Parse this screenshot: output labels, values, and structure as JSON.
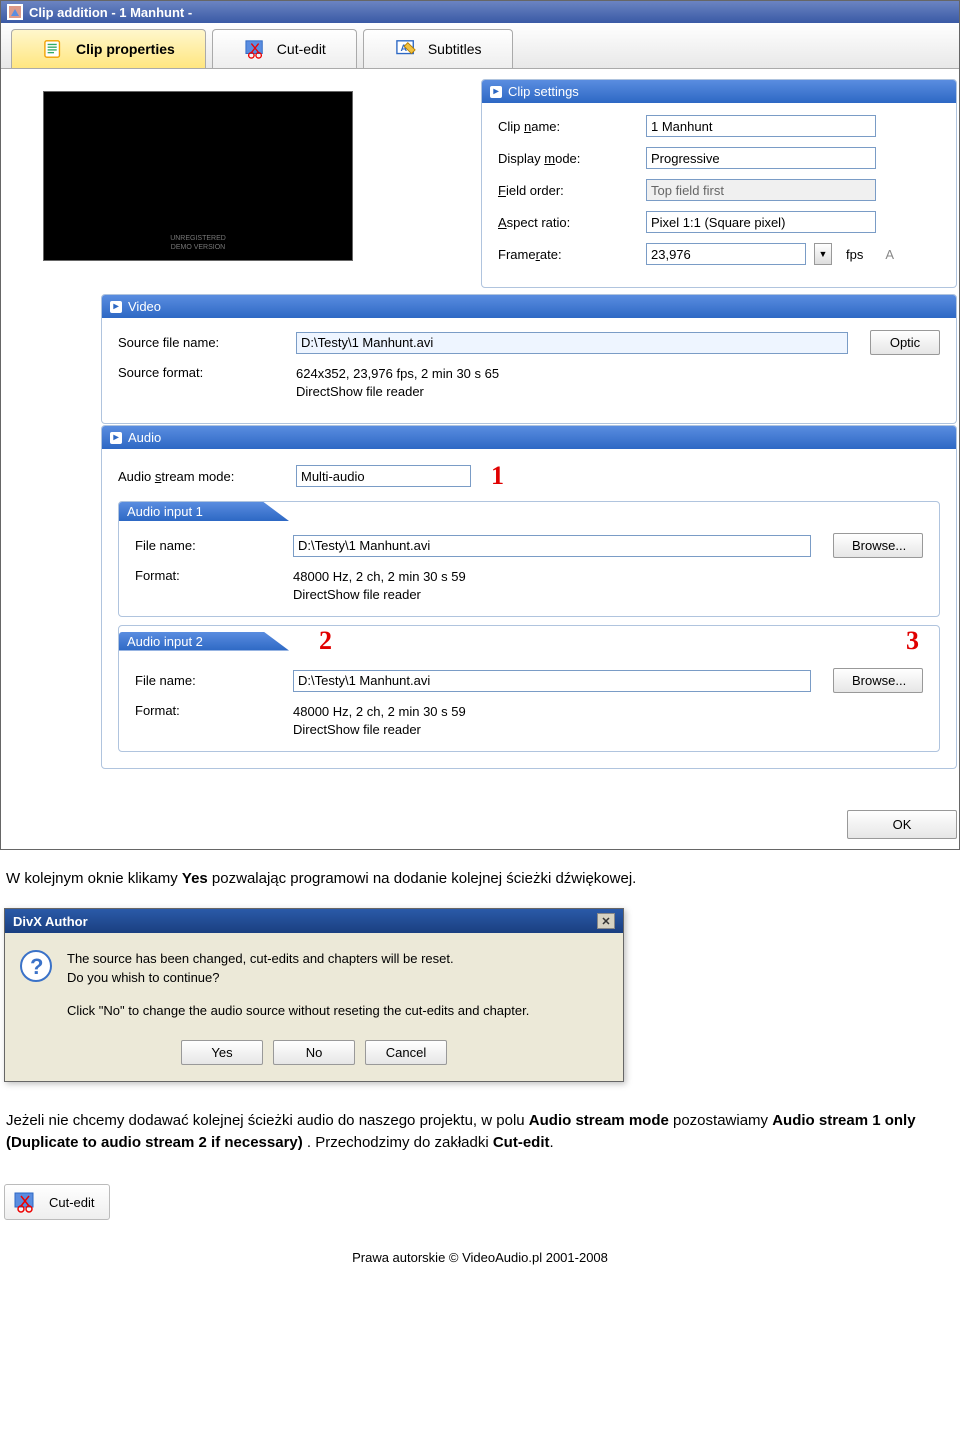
{
  "window": {
    "title": "Clip addition - 1 Manhunt -"
  },
  "tabs": {
    "clip_properties": "Clip properties",
    "cut_edit": "Cut-edit",
    "subtitles": "Subtitles"
  },
  "clip_settings": {
    "header": "Clip settings",
    "clip_name_label": "Clip name:",
    "clip_name_value": "1 Manhunt",
    "display_mode_label": "Display mode:",
    "display_mode_value": "Progressive",
    "field_order_label": "Field order:",
    "field_order_value": "Top field first",
    "aspect_ratio_label": "Aspect ratio:",
    "aspect_ratio_value": "Pixel 1:1 (Square pixel)",
    "framerate_label": "Framerate:",
    "framerate_value": "23,976",
    "fps_unit": "fps",
    "ar_btn": "A"
  },
  "video": {
    "header": "Video",
    "source_file_label": "Source file name:",
    "source_file_value": "D:\\Testy\\1 Manhunt.avi",
    "source_format_label": "Source format:",
    "source_format_value_l1": "624x352, 23,976 fps, 2 min 30 s 65",
    "source_format_value_l2": "DirectShow file reader",
    "option_btn": "Optic"
  },
  "audio": {
    "header": "Audio",
    "stream_mode_label": "Audio stream mode:",
    "stream_mode_value": "Multi-audio",
    "marker1": "1",
    "input1": {
      "header": "Audio input 1",
      "file_name_label": "File name:",
      "file_name_value": "D:\\Testy\\1 Manhunt.avi",
      "format_label": "Format:",
      "format_l1": "48000 Hz, 2 ch, 2 min 30 s 59",
      "format_l2": "DirectShow file reader",
      "browse": "Browse..."
    },
    "input2": {
      "header": "Audio input 2",
      "marker2": "2",
      "marker3": "3",
      "file_name_label": "File name:",
      "file_name_value": "D:\\Testy\\1 Manhunt.avi",
      "format_label": "Format:",
      "format_l1": "48000 Hz, 2 ch, 2 min 30 s 59",
      "format_l2": "DirectShow file reader",
      "browse": "Browse..."
    }
  },
  "ok_label": "OK",
  "doc": {
    "p1_a": "W kolejnym oknie klikamy ",
    "p1_b": "Yes",
    "p1_c": " pozwalając programowi na dodanie kolejnej ścieżki dźwiękowej.",
    "p2_a": "Jeżeli nie chcemy dodawać kolejnej ścieżki audio do naszego projektu, w polu ",
    "p2_b": "Audio stream mode",
    "p2_c": " pozostawiamy ",
    "p2_d": "Audio stream 1 only (Duplicate to audio stream 2 if necessary)",
    "p2_e": " . Przechodzimy do zakładki ",
    "p2_f": "Cut-edit",
    "p2_g": "."
  },
  "dialog": {
    "title": "DivX Author",
    "msg_l1": "The source has been changed, cut-edits and chapters will be reset.",
    "msg_l2": "Do you whish to continue?",
    "msg_l3": "Click \"No\" to change the audio source without reseting the cut-edits and chapter.",
    "yes": "Yes",
    "no": "No",
    "cancel": "Cancel"
  },
  "cutedit_btn": "Cut-edit",
  "copyright": "Prawa autorskie © VideoAudio.pl 2001-2008"
}
